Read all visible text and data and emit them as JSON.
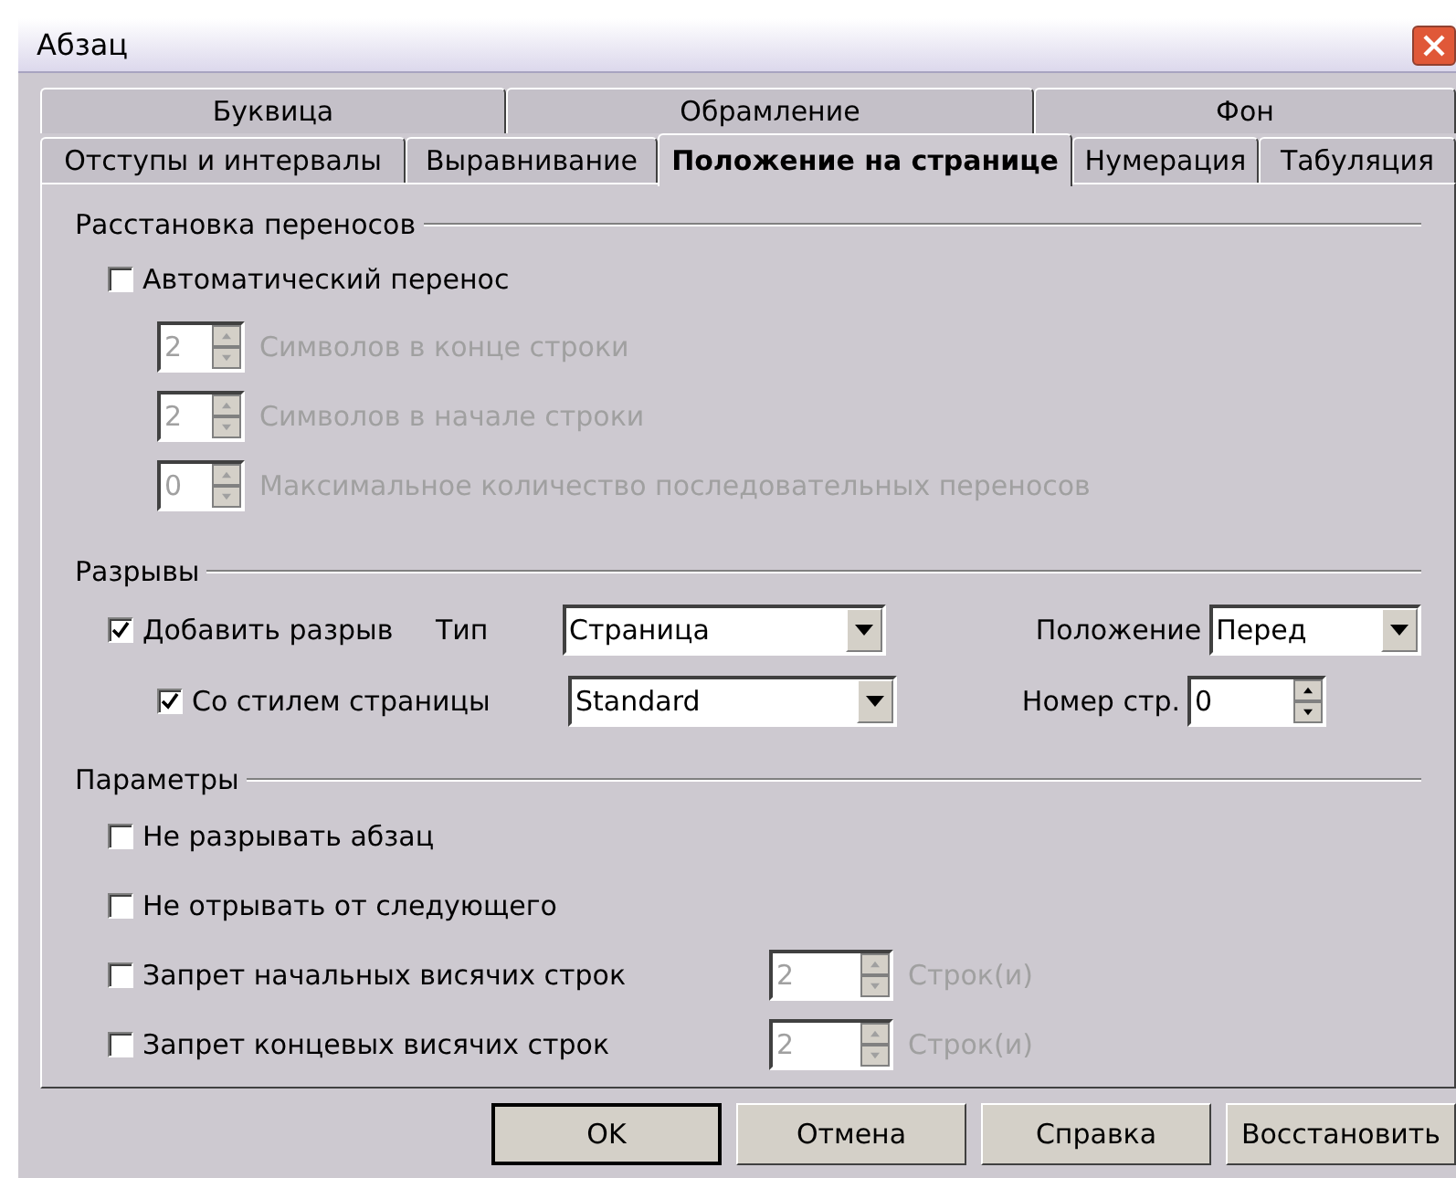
{
  "window": {
    "title": "Абзац"
  },
  "tab_rows": [
    [
      {
        "label": "Буквица",
        "selected": false
      },
      {
        "label": "Обрамление",
        "selected": false
      },
      {
        "label": "Фон",
        "selected": false
      }
    ],
    [
      {
        "label": "Отступы и интервалы",
        "selected": false
      },
      {
        "label": "Выравнивание",
        "selected": false
      },
      {
        "label": "Положение на странице",
        "selected": true
      },
      {
        "label": "Нумерация",
        "selected": false
      },
      {
        "label": "Табуляция",
        "selected": false
      }
    ]
  ],
  "hyphenation": {
    "title": "Расстановка переносов",
    "auto": {
      "label": "Автоматический перенос",
      "checked": false
    },
    "spins": [
      {
        "value": "2",
        "label": "Символов в конце строки",
        "disabled": true
      },
      {
        "value": "2",
        "label": "Символов в начале строки",
        "disabled": true
      },
      {
        "value": "0",
        "label": "Максимальное количество последовательных переносов",
        "disabled": true
      }
    ]
  },
  "breaks": {
    "title": "Разрывы",
    "add_break": {
      "label": "Добавить разрыв",
      "checked": true
    },
    "type_label": "Тип",
    "type_value": "Страница",
    "position_label": "Положение",
    "position_value": "Перед",
    "with_style": {
      "label": "Со стилем страницы",
      "checked": true
    },
    "style_value": "Standard",
    "page_number_label": "Номер стр.",
    "page_number_value": "0"
  },
  "options": {
    "title": "Параметры",
    "items": [
      {
        "label": "Не разрывать абзац",
        "checked": false
      },
      {
        "label": "Не отрывать от следующего",
        "checked": false
      },
      {
        "label": "Запрет начальных висячих строк",
        "checked": false,
        "spin": {
          "value": "2",
          "label": "Строк(и)",
          "disabled": true
        }
      },
      {
        "label": "Запрет концевых висячих строк",
        "checked": false,
        "spin": {
          "value": "2",
          "label": "Строк(и)",
          "disabled": true
        }
      }
    ]
  },
  "buttons": [
    "OK",
    "Отмена",
    "Справка",
    "Восстановить"
  ]
}
